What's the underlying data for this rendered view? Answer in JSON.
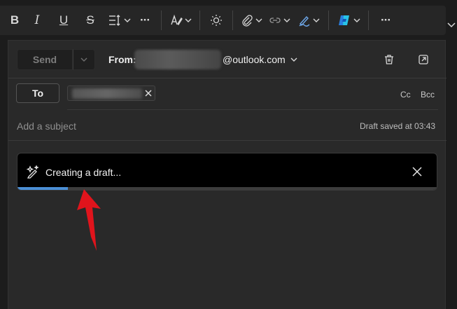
{
  "toolbar": {
    "bold_glyph": "B",
    "italic_glyph": "I",
    "underline_glyph": "U",
    "strike_glyph": "S",
    "more_glyph": "···"
  },
  "compose": {
    "send_label": "Send",
    "from_label": "From:",
    "from_domain": "@outlook.com",
    "to_label": "To",
    "cc_label": "Cc",
    "bcc_label": "Bcc",
    "subject_placeholder": "Add a subject",
    "draft_status": "Draft saved at 03:43"
  },
  "banner": {
    "text": "Creating a draft...",
    "progress": 0.12
  },
  "colors": {
    "accent": "#4b8fd6",
    "annotation_arrow": "#e0141c"
  }
}
